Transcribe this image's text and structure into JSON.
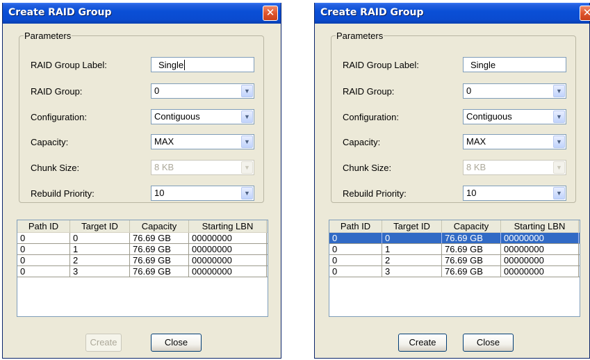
{
  "dialogs": [
    {
      "title": "Create RAID Group",
      "close_glyph": "✕",
      "parameters": {
        "legend": "Parameters",
        "label_label": "RAID Group Label:",
        "label_value": "Single",
        "group_label": "RAID Group:",
        "group_value": "0",
        "config_label": "Configuration:",
        "config_value": "Contiguous",
        "capacity_label": "Capacity:",
        "capacity_value": "MAX",
        "chunk_label": "Chunk Size:",
        "chunk_value": "8 KB",
        "priority_label": "Rebuild Priority:",
        "priority_value": "10"
      },
      "table": {
        "headers": [
          "Path ID",
          "Target ID",
          "Capacity",
          "Starting LBN"
        ],
        "rows": [
          [
            "0",
            "0",
            "76.69 GB",
            "00000000"
          ],
          [
            "0",
            "1",
            "76.69 GB",
            "00000000"
          ],
          [
            "0",
            "2",
            "76.69 GB",
            "00000000"
          ],
          [
            "0",
            "3",
            "76.69 GB",
            "00000000"
          ]
        ],
        "selected_row": null
      },
      "buttons": {
        "create": "Create",
        "close": "Close",
        "create_enabled": false
      }
    },
    {
      "title": "Create RAID Group",
      "close_glyph": "✕",
      "parameters": {
        "legend": "Parameters",
        "label_label": "RAID Group Label:",
        "label_value": "Single",
        "group_label": "RAID Group:",
        "group_value": "0",
        "config_label": "Configuration:",
        "config_value": "Contiguous",
        "capacity_label": "Capacity:",
        "capacity_value": "MAX",
        "chunk_label": "Chunk Size:",
        "chunk_value": "8 KB",
        "priority_label": "Rebuild Priority:",
        "priority_value": "10"
      },
      "table": {
        "headers": [
          "Path ID",
          "Target ID",
          "Capacity",
          "Starting LBN"
        ],
        "rows": [
          [
            "0",
            "0",
            "76.69 GB",
            "00000000"
          ],
          [
            "0",
            "1",
            "76.69 GB",
            "00000000"
          ],
          [
            "0",
            "2",
            "76.69 GB",
            "00000000"
          ],
          [
            "0",
            "3",
            "76.69 GB",
            "00000000"
          ]
        ],
        "selected_row": 0
      },
      "buttons": {
        "create": "Create",
        "close": "Close",
        "create_enabled": true
      }
    }
  ],
  "colors": {
    "title_bar": "#0a4fd6",
    "dialog_bg": "#ece9d8",
    "selection": "#316ac5",
    "close_button": "#e0562e"
  }
}
